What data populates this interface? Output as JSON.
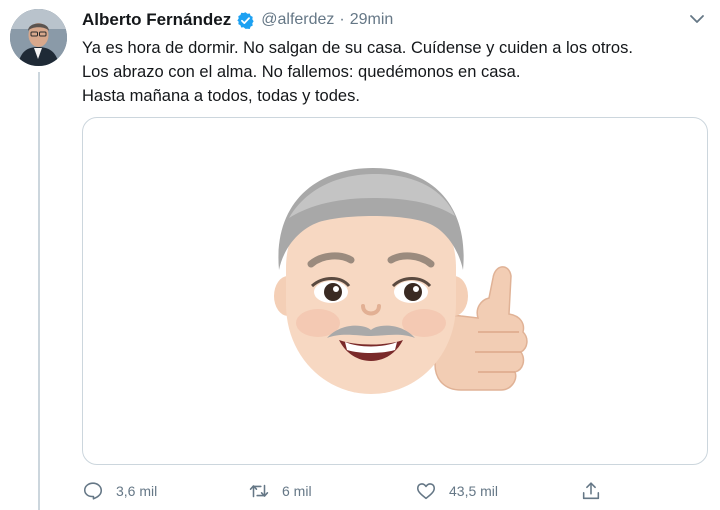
{
  "tweet": {
    "author_name": "Alberto Fernández",
    "handle": "@alferdez",
    "separator": "·",
    "time": "29min",
    "verified_icon": "verified-badge-icon",
    "text_lines": [
      "Ya es hora de dormir. No salgan de su casa. Cuídense y cuiden a los otros.",
      "Los abrazo con el alma. No fallemos: quedémonos en casa.",
      "Hasta mañana a todos, todas y todes."
    ],
    "media_description_icon": "memoji-thumbs-up-icon"
  },
  "actions": {
    "reply": {
      "icon": "reply-icon",
      "count": "3,6 mil"
    },
    "retweet": {
      "icon": "retweet-icon",
      "count": "6 mil"
    },
    "like": {
      "icon": "heart-icon",
      "count": "43,5 mil"
    },
    "share": {
      "icon": "share-icon"
    }
  },
  "colors": {
    "verified_blue": "#1da1f2",
    "secondary_text": "#657786",
    "border": "#ccd6dd"
  }
}
